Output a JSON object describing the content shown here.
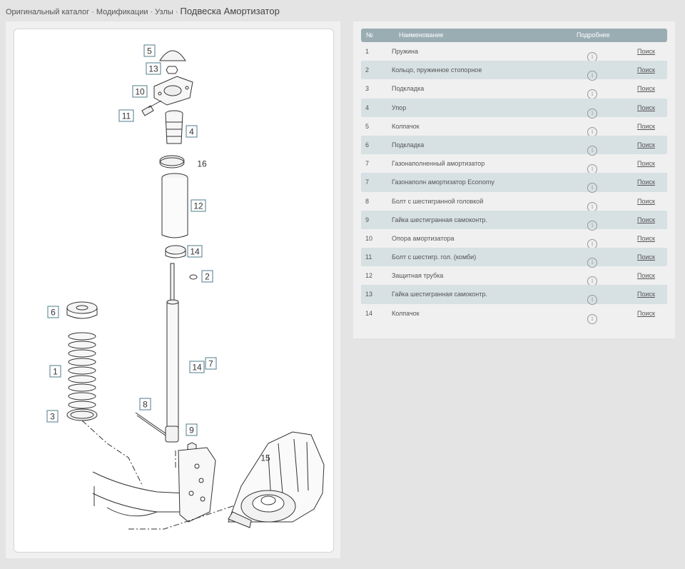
{
  "breadcrumb": {
    "items": [
      "Оригинальный каталог",
      "Модификации",
      "Узлы"
    ],
    "separator": "·",
    "current": "Подвеска Амортизатор"
  },
  "table": {
    "headers": {
      "no": "№",
      "name": "Наименование",
      "details": "Подробнее"
    },
    "search_label": "Поиск",
    "rows": [
      {
        "no": "1",
        "name": "Пружина"
      },
      {
        "no": "2",
        "name": "Кольцо, пружинное стопорное"
      },
      {
        "no": "3",
        "name": "Подкладка"
      },
      {
        "no": "4",
        "name": "Упор"
      },
      {
        "no": "5",
        "name": "Колпачок"
      },
      {
        "no": "6",
        "name": "Подкладка"
      },
      {
        "no": "7",
        "name": "Газонаполненный амортизатор"
      },
      {
        "no": "7",
        "name": "Газонаполн амортизатор Economy"
      },
      {
        "no": "8",
        "name": "Болт с шестигранной головкой"
      },
      {
        "no": "9",
        "name": "Гайка шестигранная самоконтр."
      },
      {
        "no": "10",
        "name": "Опора амортизатора"
      },
      {
        "no": "11",
        "name": "Болт с шестигр. гол. (комби)"
      },
      {
        "no": "12",
        "name": "Защитная трубка"
      },
      {
        "no": "13",
        "name": "Гайка шестигранная самоконтр."
      },
      {
        "no": "14",
        "name": "Колпачок"
      }
    ]
  },
  "diagram": {
    "callouts": [
      "5",
      "13",
      "10",
      "11",
      "4",
      "16",
      "12",
      "14",
      "2",
      "6",
      "1",
      "3",
      "8",
      "9",
      "7",
      "14",
      "15"
    ]
  },
  "colors": {
    "header_bg": "#9aadb3",
    "row_alt": "#d7e0e3",
    "callout_border": "#4f7b8a"
  }
}
